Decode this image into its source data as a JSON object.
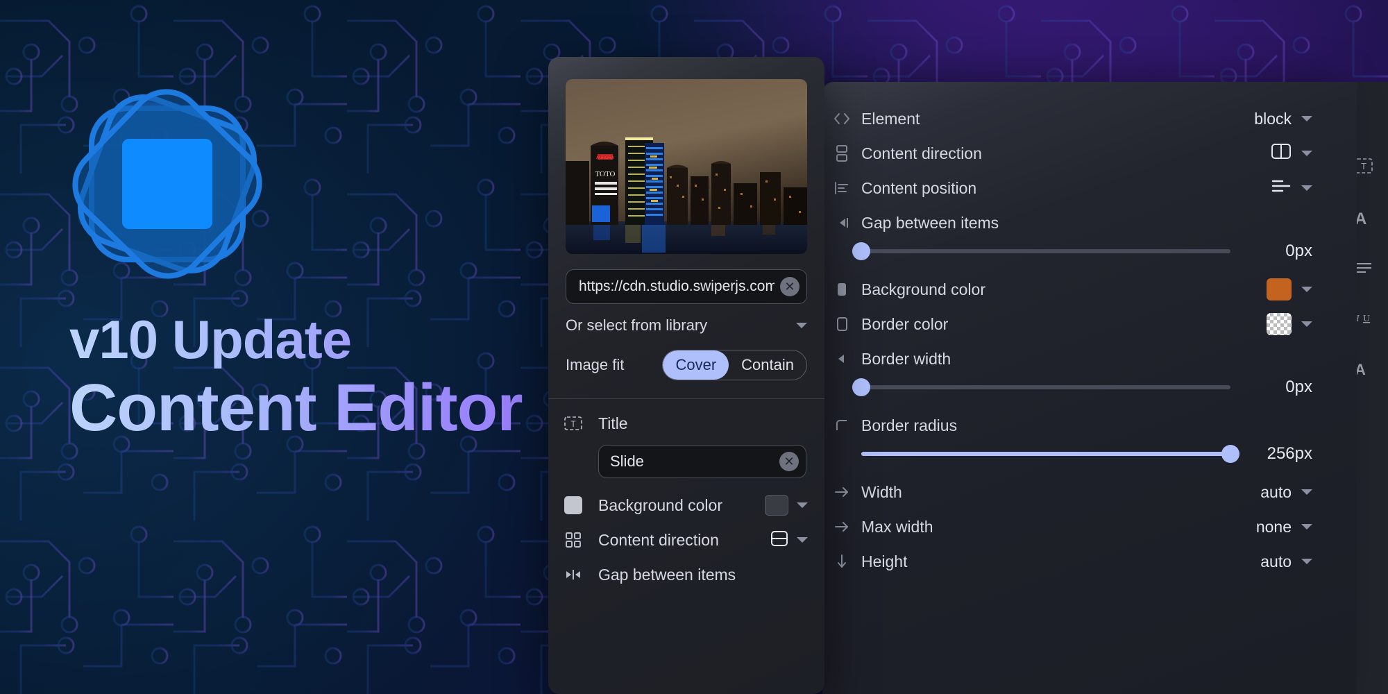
{
  "hero": {
    "logo_name": "swiper-logo",
    "line1": "v10 Update",
    "line2": "Content Editor",
    "gradient_from": "#bcd4fb",
    "gradient_to": "#9a7ffb",
    "background_accent": "#22114d"
  },
  "slide_panel": {
    "thumbnail_alt": "night city skyline",
    "url_field": {
      "value": "https://cdn.studio.swiperjs.com",
      "clear_icon": "close-circle-icon"
    },
    "library_select": {
      "label": "Or select from library",
      "icon": "chevron-down-icon"
    },
    "image_fit": {
      "label": "Image fit",
      "options": [
        "Cover",
        "Contain"
      ],
      "selected": "Cover",
      "active_color": "#aebffc"
    },
    "rows": [
      {
        "icon": "title-text-icon",
        "label": "Title",
        "type": "text",
        "value": "Slide",
        "clear_icon": "close-circle-icon"
      },
      {
        "icon": "color-square-icon",
        "label": "Background color",
        "type": "color",
        "value": "#3a3c44",
        "caret": "chevron-down-icon"
      },
      {
        "icon": "grid-four-icon",
        "label": "Content direction",
        "type": "icon-select",
        "value": "rows-split-icon",
        "caret": "chevron-down-icon"
      },
      {
        "icon": "gap-arrows-icon",
        "label": "Gap between items",
        "type": "slider"
      }
    ]
  },
  "props_panel": {
    "rows": [
      {
        "icon": "code-tag-icon",
        "label": "Element",
        "type": "select",
        "value": "block",
        "caret": "chevron-down-icon"
      },
      {
        "icon": "stack-two-icon",
        "label": "Content direction",
        "type": "icon-select",
        "value": "columns-split-icon",
        "caret": "chevron-down-icon"
      },
      {
        "icon": "align-left-icon",
        "label": "Content position",
        "type": "icon-select",
        "value": "align-lines-icon",
        "caret": "chevron-down-icon"
      },
      {
        "icon": "gap-arrows-icon",
        "label": "Gap between items",
        "type": "slider",
        "value": "0px",
        "fill_pct": 0
      },
      {
        "icon": "fill-square-icon",
        "label": "Background color",
        "type": "color",
        "value": "#c4621f",
        "caret": "chevron-down-icon"
      },
      {
        "icon": "border-square-icon",
        "label": "Border color",
        "type": "color",
        "value": "transparent",
        "caret": "chevron-down-icon"
      },
      {
        "icon": "border-width-icon",
        "label": "Border width",
        "type": "slider",
        "value": "0px",
        "fill_pct": 0
      },
      {
        "icon": "corner-radius-icon",
        "label": "Border radius",
        "type": "slider",
        "value": "256px",
        "fill_pct": 100
      },
      {
        "icon": "arrow-right-icon",
        "label": "Width",
        "type": "select",
        "value": "auto",
        "caret": "chevron-down-icon"
      },
      {
        "icon": "arrow-right-icon",
        "label": "Max width",
        "type": "select",
        "value": "none",
        "caret": "chevron-down-icon"
      },
      {
        "icon": "arrow-down-icon",
        "label": "Height",
        "type": "select",
        "value": "auto",
        "caret": "chevron-down-icon"
      }
    ]
  },
  "text_toolbar": {
    "items": [
      {
        "icon": "text-box-icon",
        "label": "T"
      },
      {
        "icon": "font-size-icon",
        "label": "A"
      },
      {
        "icon": "line-height-icon",
        "label": "☰"
      },
      {
        "icon": "text-style-icon",
        "label": "IU"
      },
      {
        "icon": "font-weight-icon",
        "label": "A"
      }
    ]
  }
}
